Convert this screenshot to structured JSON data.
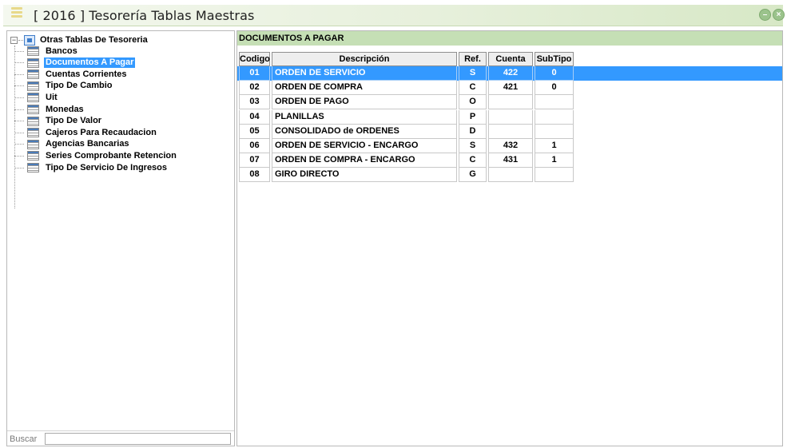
{
  "window": {
    "title": "[ 2016 ] Tesorería Tablas Maestras",
    "menu_icon": "hamburger-menu-icon",
    "minimize_icon": "minimize-circle-icon",
    "close_icon": "close-circle-icon",
    "accent_color": "#c5dfb5",
    "selection_color": "#3399ff"
  },
  "tree": {
    "root_label": "Otras Tablas De Tesoreria",
    "items": [
      {
        "label": "Bancos",
        "selected": false
      },
      {
        "label": "Documentos A Pagar",
        "selected": true
      },
      {
        "label": "Cuentas Corrientes",
        "selected": false
      },
      {
        "label": "Tipo De Cambio",
        "selected": false
      },
      {
        "label": "Uit",
        "selected": false
      },
      {
        "label": "Monedas",
        "selected": false
      },
      {
        "label": "Tipo De Valor",
        "selected": false
      },
      {
        "label": "Cajeros Para Recaudacion",
        "selected": false
      },
      {
        "label": "Agencias Bancarias",
        "selected": false
      },
      {
        "label": "Series Comprobante Retencion",
        "selected": false
      },
      {
        "label": "Tipo De Servicio De Ingresos",
        "selected": false
      }
    ]
  },
  "search": {
    "label": "Buscar",
    "value": ""
  },
  "section": {
    "title": "DOCUMENTOS A PAGAR"
  },
  "table": {
    "columns": [
      "Codigo",
      "Descripción",
      "Ref.",
      "Cuenta",
      "SubTipo"
    ],
    "rows": [
      {
        "codigo": "01",
        "descripcion": "ORDEN DE SERVICIO",
        "ref": "S",
        "cuenta": "422",
        "subtipo": "0",
        "selected": true
      },
      {
        "codigo": "02",
        "descripcion": "ORDEN DE COMPRA",
        "ref": "C",
        "cuenta": "421",
        "subtipo": "0",
        "selected": false
      },
      {
        "codigo": "03",
        "descripcion": "ORDEN DE PAGO",
        "ref": "O",
        "cuenta": "",
        "subtipo": "",
        "selected": false
      },
      {
        "codigo": "04",
        "descripcion": "PLANILLAS",
        "ref": "P",
        "cuenta": "",
        "subtipo": "",
        "selected": false
      },
      {
        "codigo": "05",
        "descripcion": "CONSOLIDADO de ORDENES",
        "ref": "D",
        "cuenta": "",
        "subtipo": "",
        "selected": false
      },
      {
        "codigo": "06",
        "descripcion": "ORDEN DE SERVICIO - ENCARGO",
        "ref": "S",
        "cuenta": "432",
        "subtipo": "1",
        "selected": false
      },
      {
        "codigo": "07",
        "descripcion": "ORDEN DE COMPRA - ENCARGO",
        "ref": "C",
        "cuenta": "431",
        "subtipo": "1",
        "selected": false
      },
      {
        "codigo": "08",
        "descripcion": "GIRO DIRECTO",
        "ref": "G",
        "cuenta": "",
        "subtipo": "",
        "selected": false
      }
    ]
  }
}
